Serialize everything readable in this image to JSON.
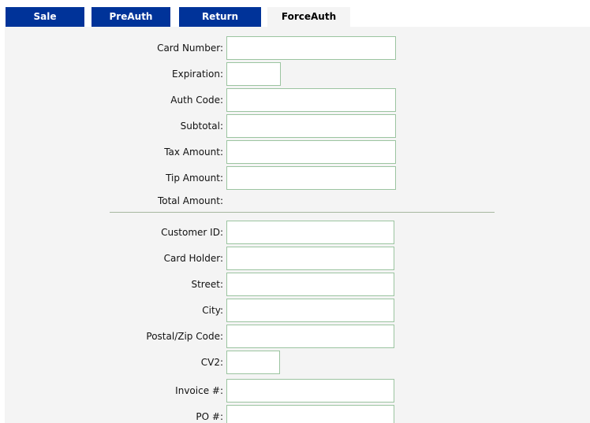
{
  "tabs": {
    "sale": "Sale",
    "preauth": "PreAuth",
    "return": "Return",
    "forceauth": "ForceAuth"
  },
  "payment": {
    "card_number": {
      "label": "Card Number:",
      "value": ""
    },
    "expiration": {
      "label": "Expiration:",
      "value": ""
    },
    "auth_code": {
      "label": "Auth Code:",
      "value": ""
    },
    "subtotal": {
      "label": "Subtotal:",
      "value": ""
    },
    "tax_amount": {
      "label": "Tax Amount:",
      "value": ""
    },
    "tip_amount": {
      "label": "Tip Amount:",
      "value": ""
    },
    "total_amount": {
      "label": "Total Amount:",
      "value": ""
    }
  },
  "customer": {
    "customer_id": {
      "label": "Customer ID:",
      "value": ""
    },
    "card_holder": {
      "label": "Card Holder:",
      "value": ""
    },
    "street": {
      "label": "Street:",
      "value": ""
    },
    "city": {
      "label": "City:",
      "value": ""
    },
    "postal_zip": {
      "label": "Postal/Zip Code:",
      "value": ""
    },
    "cv2": {
      "label": "CV2:",
      "value": ""
    },
    "invoice": {
      "label": "Invoice #:",
      "value": ""
    },
    "po": {
      "label": "PO #:",
      "value": ""
    }
  },
  "colors": {
    "tab_inactive_bg": "#003399",
    "tab_active_bg": "#f4f4f4",
    "panel_bg": "#f4f4f4",
    "field_border": "#9bc4a0",
    "divider": "#a7b8a0"
  }
}
